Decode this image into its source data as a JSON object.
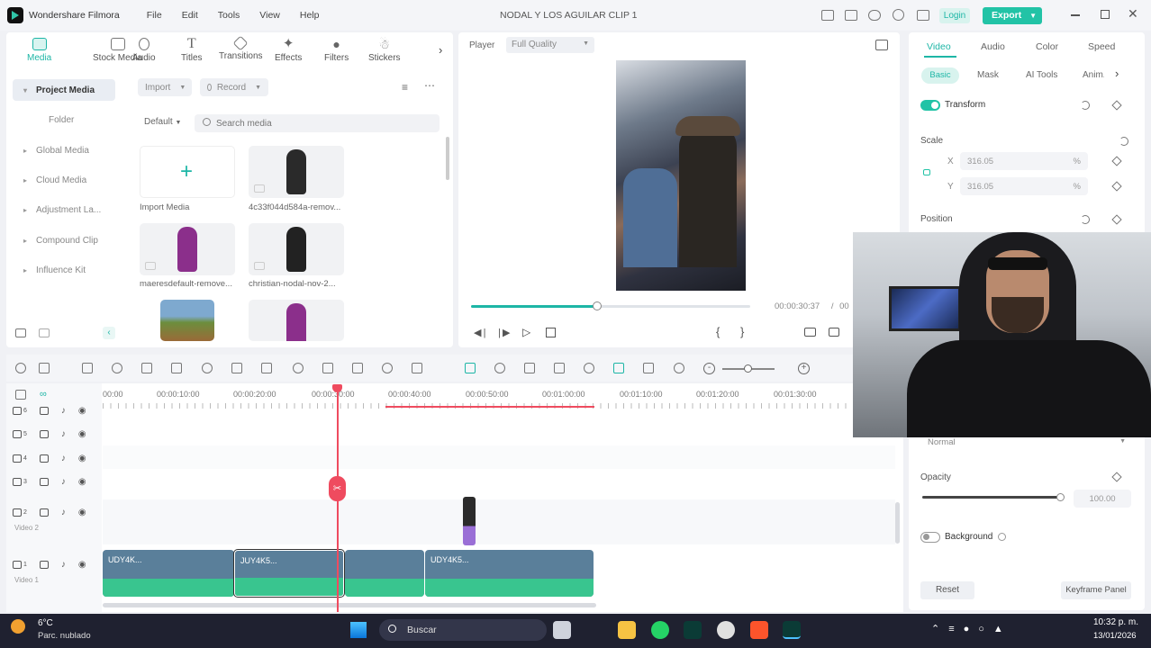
{
  "titlebar": {
    "app_name": "Wondershare Filmora",
    "menu": [
      "File",
      "Edit",
      "Tools",
      "View",
      "Help"
    ],
    "project_title": "NODAL Y LOS AGUILAR CLIP 1",
    "login_label": "Login",
    "export_label": "Export"
  },
  "media_tabs": [
    "Media",
    "Stock Media",
    "Audio",
    "Titles",
    "Transitions",
    "Effects",
    "Filters",
    "Stickers"
  ],
  "sidebar": {
    "items": [
      "Project Media",
      "Folder",
      "Global Media",
      "Cloud Media",
      "Adjustment La...",
      "Compound Clip",
      "Influence Kit"
    ]
  },
  "media_toolbar": {
    "import_label": "Import",
    "record_label": "Record",
    "sort_label": "Default",
    "search_placeholder": "Search media"
  },
  "media_items": [
    {
      "label": "Import Media"
    },
    {
      "label": "4c33f044d584a-remov..."
    },
    {
      "label": "maeresdefault-remove..."
    },
    {
      "label": "christian-nodal-nov-2..."
    }
  ],
  "player": {
    "label": "Player",
    "quality": "Full Quality",
    "timecode": "00:00:30:37",
    "timecode_sep": "/",
    "timecode_total_fragment": "00",
    "progress": 0.45
  },
  "ruler": [
    "00:00",
    "00:00:10:00",
    "00:00:20:00",
    "00:00:30:00",
    "00:00:40:00",
    "00:00:50:00",
    "00:01:00:00",
    "00:01:10:00",
    "00:01:20:00",
    "00:01:30:00"
  ],
  "tracks": [
    {
      "num": "6"
    },
    {
      "num": "5"
    },
    {
      "num": "4"
    },
    {
      "num": "3"
    },
    {
      "num": "2",
      "name": "Video 2"
    },
    {
      "num": "1",
      "name": "Video 1"
    }
  ],
  "clips": [
    {
      "label": "UDY4K..."
    },
    {
      "label": "JUY4K5..."
    },
    {
      "label": ""
    },
    {
      "label": "UDY4K5..."
    }
  ],
  "right_panel": {
    "tabs": [
      "Video",
      "Audio",
      "Color",
      "Speed"
    ],
    "subtabs": [
      "Basic",
      "Mask",
      "AI Tools",
      "Anim..."
    ],
    "transform_label": "Transform",
    "scale_label": "Scale",
    "scale_x_axis": "X",
    "scale_y_axis": "Y",
    "scale_x": "316.05",
    "scale_y": "316.05",
    "scale_unit": "%",
    "position_label": "Position",
    "blend_mode": "Normal",
    "opacity_label": "Opacity",
    "opacity_value": "100.00",
    "opacity_level": 1.0,
    "background_label": "Background",
    "reset_label": "Reset",
    "keyframe_label": "Keyframe Panel"
  },
  "taskbar": {
    "temp": "6°C",
    "weather": "Parc. nublado",
    "search_label": "Buscar",
    "time": "10:32 p. m.",
    "date": "13/01/2026"
  },
  "colors": {
    "accent": "#1db6a6",
    "export_bg": "#22c3a6",
    "playhead": "#ef4b5f",
    "audio_wave": "#39c58f",
    "taskbar_bg": "#1f2130"
  }
}
